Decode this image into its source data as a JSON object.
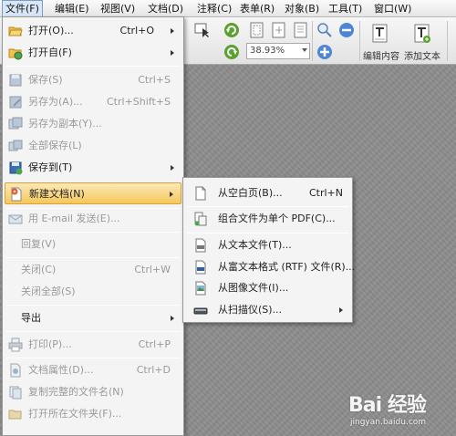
{
  "menubar": {
    "items": [
      {
        "label": "文件(F)"
      },
      {
        "label": "编辑(E)"
      },
      {
        "label": "视图(V)"
      },
      {
        "label": "文档(D)"
      },
      {
        "label": "注释(C)"
      },
      {
        "label": "表单(R)"
      },
      {
        "label": "对象(B)"
      },
      {
        "label": "工具(T)"
      },
      {
        "label": "窗口(W)"
      }
    ]
  },
  "toolbar": {
    "zoom_value": "38.93%",
    "edit_content_label": "编辑内容",
    "add_text_label": "添加文本"
  },
  "file_menu": {
    "items": [
      {
        "label": "打开(O)...",
        "shortcut": "Ctrl+O"
      },
      {
        "label": "打开自(F)"
      },
      {
        "label": "保存(S)",
        "shortcut": "Ctrl+S"
      },
      {
        "label": "另存为(A)...",
        "shortcut": "Ctrl+Shift+S"
      },
      {
        "label": "另存为副本(Y)..."
      },
      {
        "label": "全部保存(L)"
      },
      {
        "label": "保存到(T)"
      },
      {
        "label": "新建文档(N)"
      },
      {
        "label": "用 E-mail 发送(E)..."
      },
      {
        "label": "回复(V)"
      },
      {
        "label": "关闭(C)",
        "shortcut": "Ctrl+W"
      },
      {
        "label": "关闭全部(S)"
      },
      {
        "label": "导出"
      },
      {
        "label": "打印(P)...",
        "shortcut": "Ctrl+P"
      },
      {
        "label": "文档属性(D)...",
        "shortcut": "Ctrl+D"
      },
      {
        "label": "复制完整的文件名(N)"
      },
      {
        "label": "打开所在文件夹(F)..."
      }
    ]
  },
  "sub_menu": {
    "items": [
      {
        "label": "从空白页(B)...",
        "shortcut": "Ctrl+N"
      },
      {
        "label": "组合文件为单个 PDF(C)..."
      },
      {
        "label": "从文本文件(T)..."
      },
      {
        "label": "从富文本格式 (RTF) 文件(R)..."
      },
      {
        "label": "从图像文件(I)..."
      },
      {
        "label": "从扫描仪(S)..."
      }
    ]
  },
  "watermark": {
    "brand": "Bai 经验",
    "url": "jingyan.baidu.com"
  },
  "colors": {
    "highlight": "#f6c85c",
    "menu_bg": "#f4f4f4",
    "doc_bg": "#8d8d8d"
  }
}
